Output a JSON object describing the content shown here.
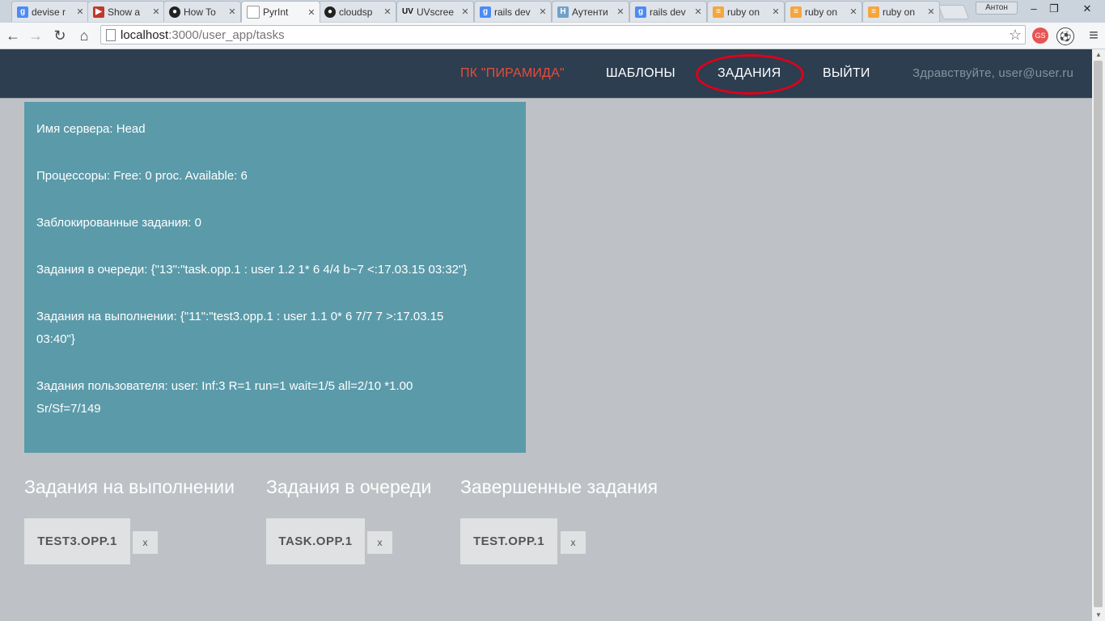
{
  "browser": {
    "tabs": [
      {
        "label": "devise r",
        "icon": "google-icon"
      },
      {
        "label": "Show a",
        "icon": "youtube-icon"
      },
      {
        "label": "How To",
        "icon": "github-icon"
      },
      {
        "label": "PyrInt",
        "icon": "document-icon"
      },
      {
        "label": "cloudsp",
        "icon": "github-icon"
      },
      {
        "label": "UVscree",
        "icon": "uv-icon"
      },
      {
        "label": "rails dev",
        "icon": "google-icon"
      },
      {
        "label": "Аутенти",
        "icon": "habr-icon"
      },
      {
        "label": "rails dev",
        "icon": "google-icon"
      },
      {
        "label": "ruby on",
        "icon": "stackoverflow-icon"
      },
      {
        "label": "ruby on",
        "icon": "stackoverflow-icon"
      },
      {
        "label": "ruby on",
        "icon": "stackoverflow-icon"
      }
    ],
    "user_badge": "Антон",
    "url_host": "localhost",
    "url_rest": ":3000/user_app/tasks"
  },
  "nav": {
    "brand": "ПК \"ПИРАМИДА\"",
    "templates": "ШАБЛОНЫ",
    "tasks": "ЗАДАНИЯ",
    "logout": "ВЫЙТИ",
    "greeting": "Здравствуйте, user@user.ru"
  },
  "info": {
    "server_label": "Имя сервера:",
    "server_value": " Head",
    "cpu_label": "Процессоры:",
    "cpu_value": " Free: 0 proc. Available: 6",
    "blocked_label": "Заблокированные задания:",
    "blocked_value": " 0",
    "queued_label": "Задания в очереди:",
    "queued_value": " {\"13\":\"task.opp.1 : user 1.2 1* 6 4/4 b~7 <:17.03.15 03:32\"}",
    "running_label": "Задания на выполнении:",
    "running_value": " {\"11\":\"test3.opp.1 : user 1.1 0* 6 7/7 7 >:17.03.15 03:40\"}",
    "user_label": "Задания пользователя:",
    "user_value": " user: Inf:3 R=1 run=1 wait=1/5 all=2/10 *1.00 Sr/Sf=7/149"
  },
  "columns": {
    "running": {
      "title": "Задания на выполнении",
      "task": "TEST3.OPP.1",
      "remove": "x"
    },
    "queued": {
      "title": "Задания в очереди",
      "task": "TASK.OPP.1",
      "remove": "x"
    },
    "done": {
      "title": "Завершенные задания",
      "task": "TEST.OPP.1",
      "remove": "x"
    }
  }
}
